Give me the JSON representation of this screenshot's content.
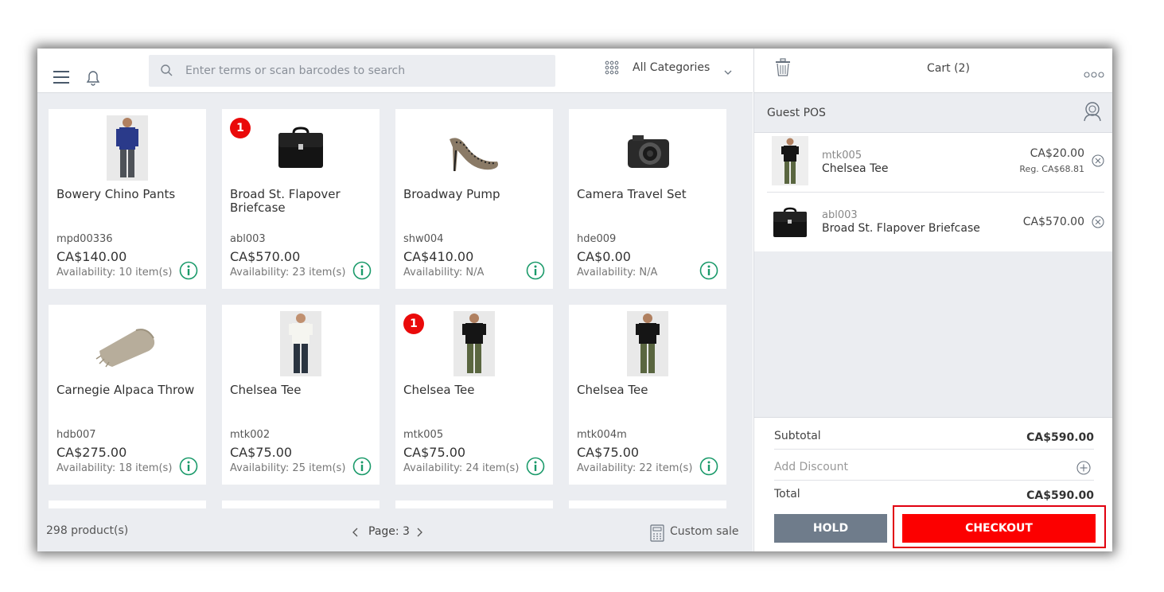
{
  "search": {
    "placeholder": "Enter terms or scan barcodes to search"
  },
  "categories": {
    "label": "All Categories"
  },
  "products": [
    {
      "name": "Bowery Chino Pants",
      "sku": "mpd00336",
      "price": "CA$140.00",
      "availability": "Availability: 10 item(s)",
      "badge": "",
      "image": "pants-person"
    },
    {
      "name": "Broad St. Flapover Briefcase",
      "sku": "abl003",
      "price": "CA$570.00",
      "availability": "Availability: 23 item(s)",
      "badge": "1",
      "image": "briefcase"
    },
    {
      "name": "Broadway Pump",
      "sku": "shw004",
      "price": "CA$410.00",
      "availability": "Availability: N/A",
      "badge": "",
      "image": "pump-shoe"
    },
    {
      "name": "Camera Travel Set",
      "sku": "hde009",
      "price": "CA$0.00",
      "availability": "Availability: N/A",
      "badge": "",
      "image": "camera"
    },
    {
      "name": "Carnegie Alpaca Throw",
      "sku": "hdb007",
      "price": "CA$275.00",
      "availability": "Availability: 18 item(s)",
      "badge": "",
      "image": "throw-blanket"
    },
    {
      "name": "Chelsea Tee",
      "sku": "mtk002",
      "price": "CA$75.00",
      "availability": "Availability: 25 item(s)",
      "badge": "",
      "image": "white-tee-person"
    },
    {
      "name": "Chelsea Tee",
      "sku": "mtk005",
      "price": "CA$75.00",
      "availability": "Availability: 24 item(s)",
      "badge": "1",
      "image": "black-tee-person"
    },
    {
      "name": "Chelsea Tee",
      "sku": "mtk004m",
      "price": "CA$75.00",
      "availability": "Availability: 22 item(s)",
      "badge": "",
      "image": "black-tee-person"
    }
  ],
  "footer": {
    "count": "298 product(s)",
    "page": "Page: 3",
    "custom_sale": "Custom sale"
  },
  "cart": {
    "title": "Cart (2)",
    "customer": "Guest POS",
    "items": [
      {
        "sku": "mtk005",
        "name": "Chelsea Tee",
        "price": "CA$20.00",
        "regular": "Reg. CA$68.81",
        "image": "black-tee-person"
      },
      {
        "sku": "abl003",
        "name": "Broad St. Flapover Briefcase",
        "price": "CA$570.00",
        "regular": "",
        "image": "briefcase"
      }
    ],
    "subtotal_label": "Subtotal",
    "subtotal": "CA$590.00",
    "discount_label": "Add Discount",
    "total_label": "Total",
    "total": "CA$590.00",
    "hold_label": "HOLD",
    "checkout_label": "CHECKOUT"
  },
  "colors": {
    "accent_red": "#fc0000",
    "hold_gray": "#6f7c8b",
    "badge_red": "#ea0a0a",
    "info_green": "#1a9a6a",
    "background": "#ebedf1"
  }
}
